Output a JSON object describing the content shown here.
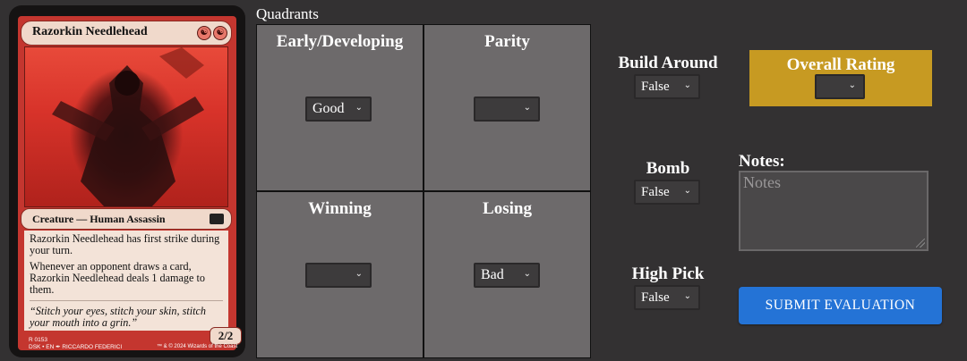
{
  "card": {
    "name": "Razorkin Needlehead",
    "mana_cost_icons": [
      "red-mana-icon",
      "red-mana-icon"
    ],
    "type_line": "Creature — Human Assassin",
    "rules_text": [
      "Razorkin Needlehead has first strike during your turn.",
      "Whenever an opponent draws a card, Razorkin Needlehead deals 1 damage to them."
    ],
    "flavor_text": "“Stitch your eyes, stitch your skin, stitch your mouth into a grin.”",
    "power_toughness": "2/2",
    "collector_line1": "R 0153",
    "collector_line2": "DSK • EN ✒ RICCARDO FEDERICI",
    "copyright": "™ & © 2024 Wizards of the Coast"
  },
  "quadrants": {
    "title": "Quadrants",
    "cells": [
      {
        "label": "Early/Developing",
        "value": "Good"
      },
      {
        "label": "Parity",
        "value": ""
      },
      {
        "label": "Winning",
        "value": ""
      },
      {
        "label": "Losing",
        "value": "Bad"
      }
    ]
  },
  "build_around": {
    "label": "Build Around",
    "value": "False"
  },
  "bomb": {
    "label": "Bomb",
    "value": "False"
  },
  "high_pick": {
    "label": "High Pick",
    "value": "False"
  },
  "overall_rating": {
    "label": "Overall Rating",
    "value": ""
  },
  "notes": {
    "label": "Notes:",
    "placeholder": "Notes"
  },
  "submit": {
    "label": "SUBMIT EVALUATION"
  },
  "colors": {
    "background": "#333132",
    "cell": "#6d6a6b",
    "overall": "#c79a22",
    "submit": "#2473d6",
    "card_frame": "#c4362f"
  }
}
